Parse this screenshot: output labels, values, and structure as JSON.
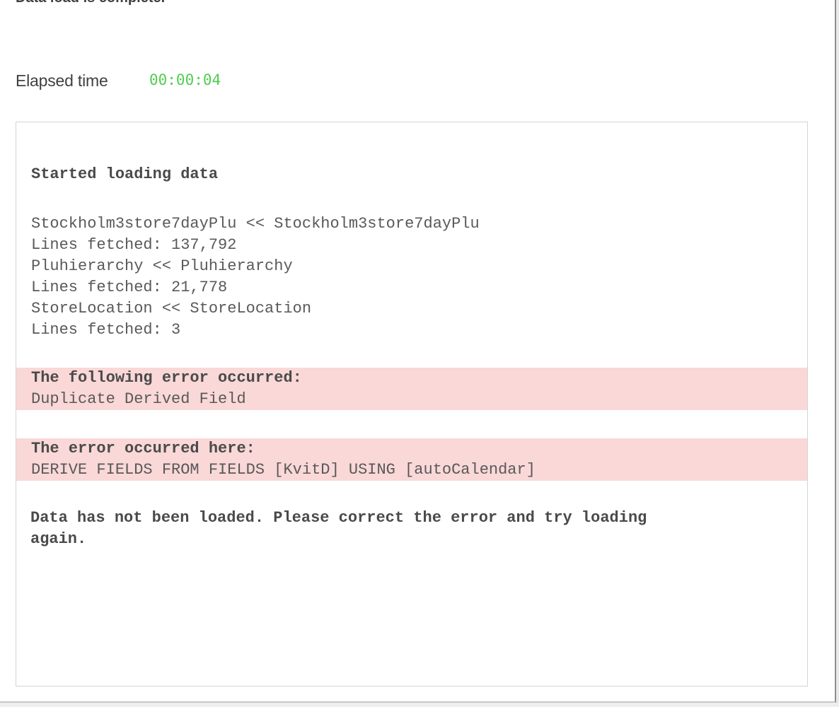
{
  "status": {
    "message": "Data load is complete."
  },
  "elapsed": {
    "label": "Elapsed time",
    "value": "00:00:04"
  },
  "log": {
    "heading": "Started loading data",
    "entries": [
      "Stockholm3store7dayPlu << Stockholm3store7dayPlu",
      "Lines fetched: 137,792",
      "Pluhierarchy << Pluhierarchy",
      "Lines fetched: 21,778",
      "StoreLocation << StoreLocation",
      "Lines fetched: 3"
    ],
    "error": {
      "heading": "The following error occurred:",
      "message": "Duplicate Derived Field"
    },
    "location": {
      "heading": "The error occurred here:",
      "statement": "DERIVE FIELDS FROM FIELDS [KvitD] USING [autoCalendar]"
    },
    "footer": "Data has not been loaded. Please correct the error and try loading",
    "footer_continued": "again."
  },
  "colors": {
    "elapsed_time": "#52cc52",
    "error_highlight": "#f9d8d7",
    "text": "#404040"
  }
}
